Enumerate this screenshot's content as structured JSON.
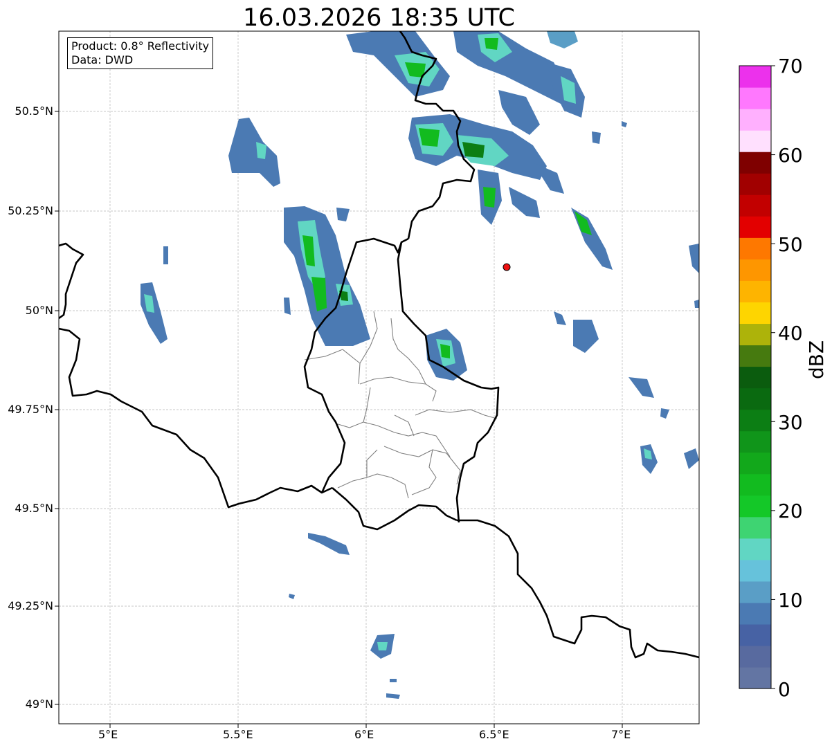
{
  "title": "16.03.2026 18:35 UTC",
  "info": {
    "product": "Product: 0.8° Reflectivity",
    "data": "Data: DWD"
  },
  "axes": {
    "lon_ticks": [
      "5°E",
      "5.5°E",
      "6°E",
      "6.5°E",
      "7°E"
    ],
    "lat_ticks": [
      "50.5°N",
      "50.25°N",
      "50°N",
      "49.75°N",
      "49.5°N",
      "49.25°N",
      "49°N"
    ],
    "lon_range": [
      4.8,
      7.3
    ],
    "lat_range": [
      48.95,
      50.7
    ]
  },
  "colorbar": {
    "label": "dBZ",
    "ticks": [
      "70",
      "60",
      "50",
      "40",
      "30",
      "20",
      "10",
      "0"
    ],
    "colors": [
      "#6375a3",
      "#586a9f",
      "#4762a4",
      "#4b7ab3",
      "#5a9ec6",
      "#66c2db",
      "#61d6c3",
      "#3ed472",
      "#14c828",
      "#12bb1f",
      "#12a81b",
      "#10951a",
      "#0c7e14",
      "#0a6a10",
      "#0b5c0e",
      "#467a0f",
      "#adb30a",
      "#fed500",
      "#feb400",
      "#fe9600",
      "#fe7800",
      "#e30000",
      "#c20000",
      "#a10000",
      "#7f0000",
      "#ffe0fe",
      "#ffb0fe",
      "#ff78fe",
      "#ec31ec"
    ]
  },
  "radar_site_color": "#ee1111",
  "grid": true
}
